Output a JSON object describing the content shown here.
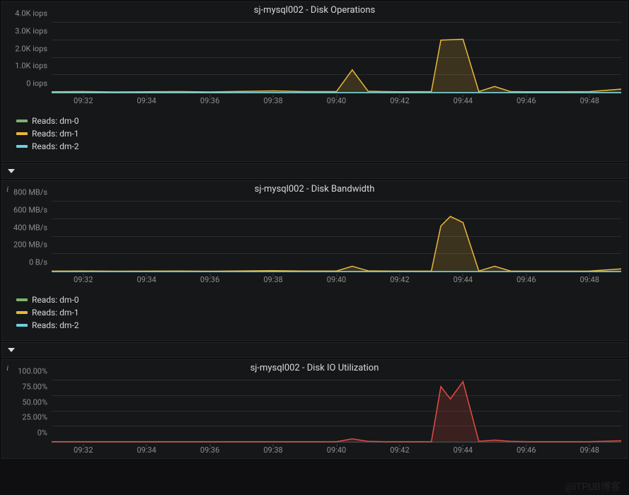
{
  "x_labels": [
    "09:32",
    "09:34",
    "09:36",
    "09:38",
    "09:40",
    "09:42",
    "09:44",
    "09:46",
    "09:48"
  ],
  "x_range_min": 0,
  "x_range_points": 100,
  "watermark": "@ITPUB博客",
  "panels": [
    {
      "id": "ops",
      "title": "sj-mysql002 - Disk Operations",
      "y_ticks": [
        "0 iops",
        "1.0K iops",
        "2.0K iops",
        "3.0K iops",
        "4.0K iops"
      ],
      "y_max": 4000,
      "legend": [
        {
          "label": "Reads: dm-0",
          "color": "#7eb26d"
        },
        {
          "label": "Reads: dm-1",
          "color": "#eab839"
        },
        {
          "label": "Reads: dm-2",
          "color": "#6ed0e0"
        }
      ]
    },
    {
      "id": "bw",
      "title": "sj-mysql002 - Disk Bandwidth",
      "y_ticks": [
        "0 B/s",
        "200 MB/s",
        "400 MB/s",
        "600 MB/s",
        "800 MB/s"
      ],
      "y_max": 800,
      "legend": [
        {
          "label": "Reads: dm-0",
          "color": "#7eb26d"
        },
        {
          "label": "Reads: dm-1",
          "color": "#eab839"
        },
        {
          "label": "Reads: dm-2",
          "color": "#6ed0e0"
        }
      ]
    },
    {
      "id": "io",
      "title": "sj-mysql002 - Disk IO Utilization",
      "y_ticks": [
        "0%",
        "25.00%",
        "50.00%",
        "75.00%",
        "100.00%"
      ],
      "y_max": 100,
      "legend": null
    }
  ],
  "chart_data": [
    {
      "type": "area",
      "title": "sj-mysql002 - Disk Operations",
      "xlabel": "",
      "ylabel": "iops",
      "ylim": [
        0,
        4000
      ],
      "x": [
        "09:31",
        "09:32",
        "09:33",
        "09:34",
        "09:35",
        "09:36",
        "09:37",
        "09:38",
        "09:39",
        "09:40",
        "09:40.5",
        "09:41",
        "09:41.5",
        "09:42",
        "09:43",
        "09:43.3",
        "09:44",
        "09:44.5",
        "09:45",
        "09:45.5",
        "09:46",
        "09:47",
        "09:48",
        "09:49"
      ],
      "series": [
        {
          "name": "Reads: dm-0",
          "color": "#7eb26d",
          "values": [
            0,
            0,
            0,
            0,
            0,
            0,
            0,
            0,
            0,
            0,
            0,
            0,
            0,
            0,
            0,
            0,
            0,
            0,
            0,
            0,
            0,
            0,
            0,
            0
          ]
        },
        {
          "name": "Reads: dm-1",
          "color": "#eab839",
          "values": [
            50,
            60,
            40,
            50,
            60,
            40,
            70,
            100,
            60,
            60,
            1300,
            80,
            60,
            50,
            60,
            3000,
            3050,
            60,
            350,
            60,
            50,
            50,
            60,
            200
          ]
        },
        {
          "name": "Reads: dm-2",
          "color": "#6ed0e0",
          "values": [
            0,
            0,
            0,
            0,
            0,
            0,
            0,
            0,
            0,
            0,
            0,
            0,
            0,
            0,
            0,
            0,
            0,
            0,
            0,
            0,
            0,
            0,
            0,
            0
          ]
        }
      ]
    },
    {
      "type": "area",
      "title": "sj-mysql002 - Disk Bandwidth",
      "xlabel": "",
      "ylabel": "MB/s",
      "ylim": [
        0,
        800
      ],
      "x": [
        "09:31",
        "09:32",
        "09:33",
        "09:34",
        "09:35",
        "09:36",
        "09:37",
        "09:38",
        "09:39",
        "09:40",
        "09:40.5",
        "09:41",
        "09:41.5",
        "09:42",
        "09:43",
        "09:43.3",
        "09:43.6",
        "09:44",
        "09:44.5",
        "09:45",
        "09:45.5",
        "09:46",
        "09:47",
        "09:48",
        "09:49"
      ],
      "series": [
        {
          "name": "Reads: dm-0",
          "color": "#7eb26d",
          "values": [
            0,
            0,
            0,
            0,
            0,
            0,
            0,
            0,
            0,
            0,
            0,
            0,
            0,
            0,
            0,
            0,
            0,
            0,
            0,
            0,
            0,
            0,
            0,
            0,
            0
          ]
        },
        {
          "name": "Reads: dm-1",
          "color": "#eab839",
          "values": [
            5,
            6,
            4,
            5,
            6,
            4,
            7,
            10,
            6,
            6,
            60,
            8,
            6,
            5,
            6,
            520,
            630,
            560,
            6,
            60,
            6,
            5,
            5,
            6,
            30
          ]
        },
        {
          "name": "Reads: dm-2",
          "color": "#6ed0e0",
          "values": [
            0,
            0,
            0,
            0,
            0,
            0,
            0,
            0,
            0,
            0,
            0,
            0,
            0,
            0,
            0,
            0,
            0,
            0,
            0,
            0,
            0,
            0,
            0,
            0,
            0
          ]
        }
      ]
    },
    {
      "type": "area",
      "title": "sj-mysql002 - Disk IO Utilization",
      "xlabel": "",
      "ylabel": "%",
      "ylim": [
        0,
        100
      ],
      "x": [
        "09:31",
        "09:32",
        "09:33",
        "09:34",
        "09:35",
        "09:36",
        "09:37",
        "09:38",
        "09:39",
        "09:40",
        "09:40.5",
        "09:41",
        "09:41.5",
        "09:42",
        "09:43",
        "09:43.3",
        "09:43.6",
        "09:44",
        "09:44.5",
        "09:45",
        "09:45.5",
        "09:46",
        "09:47",
        "09:48",
        "09:49"
      ],
      "series": [
        {
          "name": "utilization",
          "color": "#e24d42",
          "values": [
            0.5,
            0.5,
            0.5,
            0.5,
            0.5,
            0.5,
            0.5,
            0.5,
            0.5,
            0.5,
            5,
            1,
            0.5,
            0.5,
            0.5,
            90,
            70,
            98,
            1,
            3,
            1,
            0.5,
            0.5,
            0.5,
            2
          ]
        }
      ]
    }
  ]
}
